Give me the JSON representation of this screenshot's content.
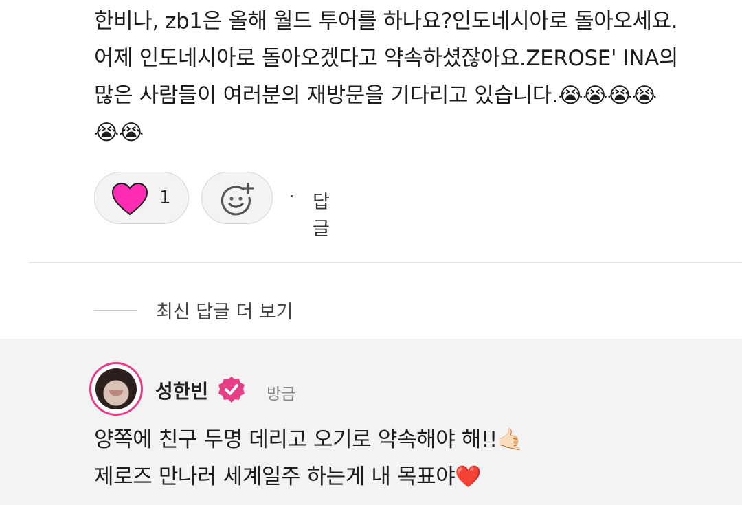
{
  "comment": {
    "text": "한비나, zb1은 올해 월드 투어를 하나요?인도네시아로 돌아오세요.\n어제 인도네시아로 돌아오겠다고 약속하셨잖아요.ZEROSE' INA의\n많은 사람들이 여러분의 재방문을 기다리고 있습니다.😭😭😭😭\n😭😭",
    "like_count": "1",
    "reply_label": "답글",
    "separator": "·"
  },
  "more_replies": {
    "label": "최신 답글 더 보기"
  },
  "reply": {
    "username": "성한빈",
    "timestamp": "방금",
    "text": "양쪽에 친구 두명 데리고 오기로 약속해야 해!!🤙🏻\n제로즈 만나러 세계일주 하는게 내 목표야❤️"
  },
  "colors": {
    "heart": "#ff2db4",
    "verified": "#e63f87",
    "reply_background": "#f3f3f3"
  },
  "icons": {
    "like": "heart-icon",
    "add_reaction": "add-reaction-icon",
    "verified": "verified-badge-icon"
  }
}
